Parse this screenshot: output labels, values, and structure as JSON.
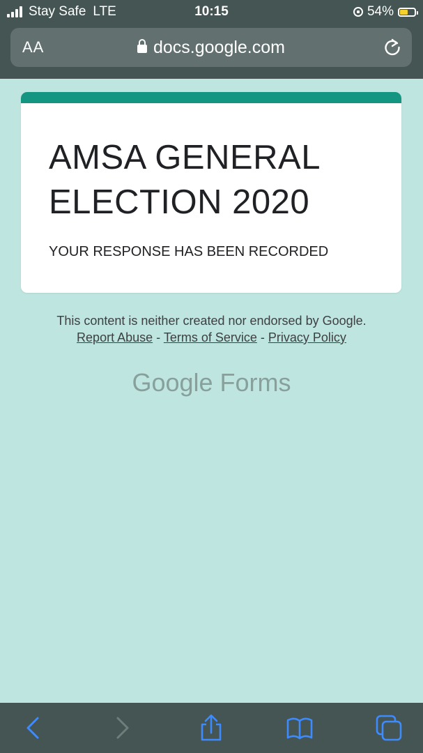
{
  "status_bar": {
    "carrier": "Stay Safe",
    "network": "LTE",
    "time": "10:15",
    "battery_percent": "54%",
    "battery_level": 0.54,
    "icons": [
      "signal-icon",
      "orientation-lock-icon",
      "battery-icon"
    ]
  },
  "browser": {
    "text_size_label": "AA",
    "url": "docs.google.com",
    "icons": [
      "padlock-icon",
      "reload-icon"
    ]
  },
  "form": {
    "title": "AMSA GENERAL ELECTION 2020",
    "confirmation": "YOUR RESPONSE HAS BEEN RECORDED",
    "accent_color": "#149582"
  },
  "footer": {
    "disclaimer": "This content is neither created nor endorsed by Google.",
    "links": [
      {
        "label": "Report Abuse"
      },
      {
        "label": "Terms of Service"
      },
      {
        "label": "Privacy Policy"
      }
    ],
    "separator": "-",
    "logo_google": "Google",
    "logo_forms": "Forms"
  },
  "toolbar": {
    "buttons": [
      "back-icon",
      "forward-icon",
      "share-icon",
      "bookmarks-icon",
      "tabs-icon"
    ]
  },
  "colors": {
    "background": "#bfe5e0",
    "chrome": "#445553",
    "url_bar": "#62716f",
    "tint": "#3d8bff"
  }
}
